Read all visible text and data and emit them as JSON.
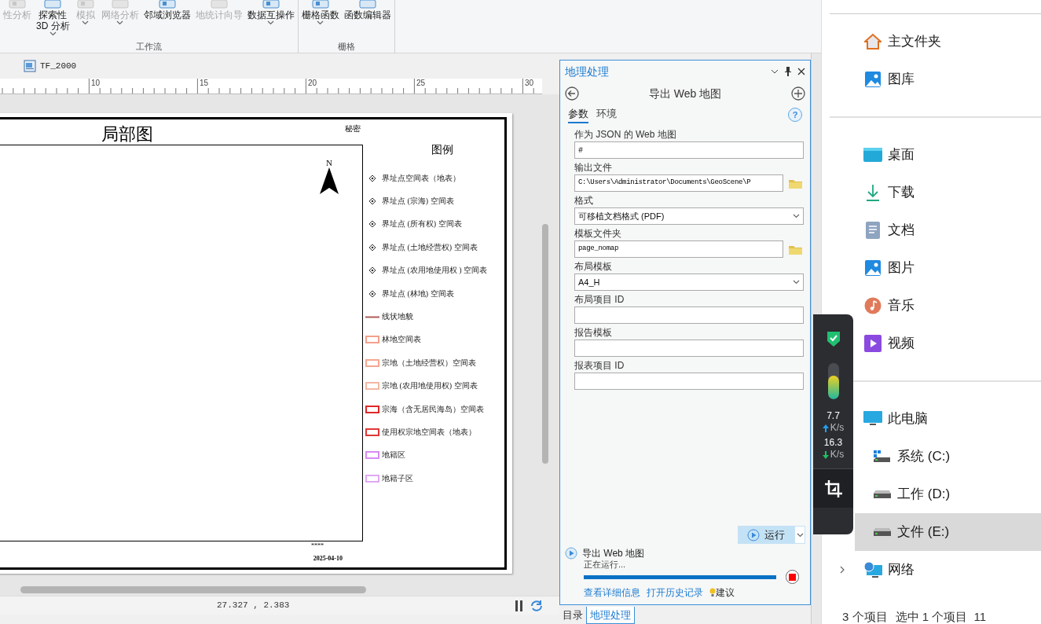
{
  "ribbon": {
    "groups": [
      {
        "label": "工作流",
        "tools": [
          {
            "lines": [
              "性分析"
            ],
            "disabled": true,
            "menu": false
          },
          {
            "lines": [
              "探索性",
              "3D 分析"
            ],
            "disabled": false,
            "menu": true
          },
          {
            "lines": [
              "模拟"
            ],
            "disabled": true,
            "menu": true
          },
          {
            "lines": [
              "网络分析"
            ],
            "disabled": true,
            "menu": true
          },
          {
            "lines": [
              "邻域浏览器"
            ],
            "disabled": false,
            "menu": false
          },
          {
            "lines": [
              "地统计向导"
            ],
            "disabled": true,
            "menu": false
          },
          {
            "lines": [
              "数据互操作"
            ],
            "disabled": false,
            "menu": true
          }
        ]
      },
      {
        "label": "栅格",
        "tools": [
          {
            "lines": [
              "栅格函数"
            ],
            "disabled": false,
            "menu": true
          },
          {
            "lines": [
              "函数编辑器"
            ],
            "disabled": false,
            "menu": false
          }
        ]
      }
    ]
  },
  "document_tab": {
    "title": "TF_2000"
  },
  "ruler": {
    "labels": [
      "10",
      "15",
      "20",
      "25",
      "30"
    ]
  },
  "layout_page": {
    "title": "局部图",
    "classification": "秘密",
    "north_label": "N",
    "footer_mark": "****",
    "date": "2025-04-10",
    "legend": {
      "title": "图例",
      "items": [
        {
          "kind": "point",
          "label": "界址点空间表（地表）",
          "color": "#333333"
        },
        {
          "kind": "point",
          "label": "界址点 (宗海) 空间表",
          "color": "#333333"
        },
        {
          "kind": "point",
          "label": "界址点 (所有权) 空间表",
          "color": "#333333"
        },
        {
          "kind": "point",
          "label": "界址点 (土地经营权) 空间表",
          "color": "#333333"
        },
        {
          "kind": "point",
          "label": "界址点 (农用地使用权 ) 空间表",
          "color": "#333333"
        },
        {
          "kind": "point",
          "label": "界址点 (林地) 空间表",
          "color": "#333333"
        },
        {
          "kind": "line",
          "label": "线状地貌",
          "color": "#b05a5a"
        },
        {
          "kind": "polygon",
          "label": "林地空间表",
          "color": "#f4a08c"
        },
        {
          "kind": "polygon",
          "label": "宗地（土地经营权）空间表",
          "color": "#f4a890"
        },
        {
          "kind": "polygon",
          "label": "宗地 (农用地使用权) 空间表",
          "color": "#f4b8a4"
        },
        {
          "kind": "polygon",
          "label": "宗海（含无居民海岛）空间表",
          "color": "#e02828"
        },
        {
          "kind": "polygon",
          "label": "使用权宗地空间表（地表）",
          "color": "#e03838"
        },
        {
          "kind": "polygon",
          "label": "地籍区",
          "color": "#d88cf4"
        },
        {
          "kind": "polygon",
          "label": "地籍子区",
          "color": "#e0a8f4"
        }
      ]
    }
  },
  "map_status": {
    "coordinates": "27.327 , 2.383"
  },
  "geoprocessing": {
    "title": "地理处理",
    "tool_title": "导出 Web 地图",
    "help_label": "?",
    "tabs": [
      {
        "label": "参数",
        "selected": true
      },
      {
        "label": "环境",
        "selected": false
      }
    ],
    "parameters": [
      {
        "kind": "text",
        "label": "作为 JSON 的 Web 地图",
        "value": "#"
      },
      {
        "kind": "file",
        "label": "输出文件",
        "value": "C:\\Users\\Administrator\\Documents\\GeoScene\\P"
      },
      {
        "kind": "dropdown",
        "label": "格式",
        "value": "可移植文档格式 (PDF)"
      },
      {
        "kind": "file",
        "label": "模板文件夹",
        "value": "page_nomap"
      },
      {
        "kind": "dropdown",
        "label": "布局模板",
        "value": "A4_H"
      },
      {
        "kind": "text",
        "label": "布局项目 ID"
      },
      {
        "kind": "text",
        "label": "报告模板"
      },
      {
        "kind": "text",
        "label": "报表项目 ID"
      }
    ],
    "run_button": "运行",
    "progress": {
      "tool": "导出 Web 地图",
      "status": "正在运行...",
      "links": [
        "查看详细信息",
        "打开历史记录"
      ],
      "suggest": "建议"
    },
    "bottom_tabs": [
      {
        "label": "目录",
        "selected": false
      },
      {
        "label": "地理处理",
        "selected": true
      }
    ]
  },
  "explorer": {
    "sections": [
      {
        "items": [
          {
            "label": "主文件夹"
          },
          {
            "label": "图库"
          }
        ]
      },
      {
        "items": [
          {
            "label": "桌面"
          },
          {
            "label": "下载"
          },
          {
            "label": "文档"
          },
          {
            "label": "图片"
          },
          {
            "label": "音乐"
          },
          {
            "label": "视频"
          }
        ]
      },
      {
        "items": [
          {
            "label": "此电脑",
            "selected": false,
            "children": [
              {
                "label": "系统 (C:)",
                "selected": false
              },
              {
                "label": "工作 (D:)",
                "selected": false
              },
              {
                "label": "文件 (E:)",
                "selected": true
              }
            ]
          },
          {
            "label": "网络",
            "expanded": false,
            "selected": false
          }
        ]
      }
    ],
    "status": [
      "3 个项目",
      "选中 1 个项目  11"
    ]
  },
  "monitor_widget": {
    "level": 0.65,
    "upload": "7.7",
    "upload_unit": "K/s",
    "download": "16.3",
    "download_unit": "K/s"
  }
}
